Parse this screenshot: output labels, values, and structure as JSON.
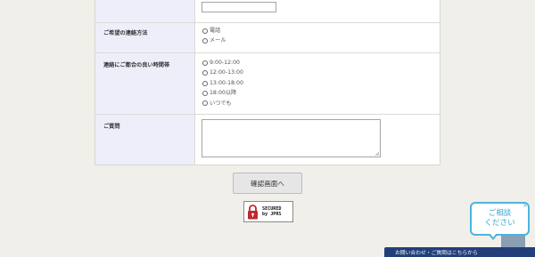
{
  "form": {
    "contact_method": {
      "label": "ご希望の連絡方法",
      "options": [
        "電話",
        "メール"
      ]
    },
    "convenient_time": {
      "label": "連絡にご都合の良い時間帯",
      "options": [
        "9:00-12:00",
        "12:00-13:00",
        "13:00-18:00",
        "18:00以降",
        "いつでも"
      ]
    },
    "question": {
      "label": "ご質問"
    }
  },
  "confirm_button": "確認画面へ",
  "jprs_seal": {
    "line1": "SECURED",
    "line2": "by JPRS"
  },
  "chat_bubble": {
    "line1": "ご相談",
    "line2": "ください",
    "close": "×"
  },
  "contact_bar": {
    "label": "お問い合わせ・ご質問はこちらから"
  }
}
